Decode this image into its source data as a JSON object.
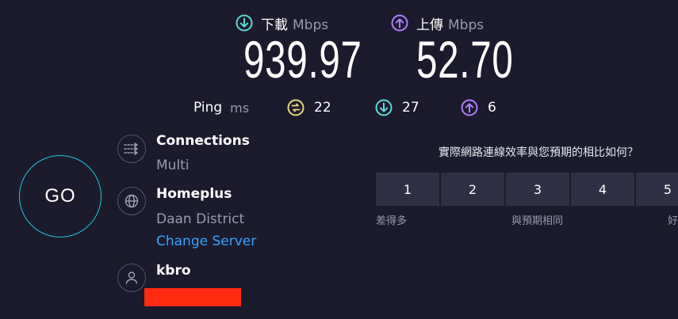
{
  "speed": {
    "download": {
      "label": "下載",
      "unit": "Mbps",
      "value": "939.97",
      "color": "#5ed8d8"
    },
    "upload": {
      "label": "上傳",
      "unit": "Mbps",
      "value": "52.70",
      "color": "#b47eff"
    }
  },
  "ping": {
    "label": "Ping",
    "unit": "ms",
    "idle": {
      "value": "22",
      "icon": "ping-idle-icon",
      "color": "#e7d77a"
    },
    "download": {
      "value": "27",
      "icon": "download-arrow-icon",
      "color": "#5ed8d8"
    },
    "upload": {
      "value": "6",
      "icon": "upload-arrow-icon",
      "color": "#b47eff"
    }
  },
  "go_label": "GO",
  "connections": {
    "title": "Connections",
    "value": "Multi"
  },
  "server": {
    "name": "Homeplus",
    "location": "Daan District",
    "change_label": "Change Server"
  },
  "provider": {
    "name": "kbro"
  },
  "rating": {
    "question": "實際網路連線效率與您預期的相比如何？",
    "options": [
      "1",
      "2",
      "3",
      "4",
      "5"
    ],
    "captions": {
      "low": "差得多",
      "mid": "與預期相同",
      "high": "好"
    }
  },
  "colors": {
    "background": "#1b1b2d",
    "go_ring": "#1fc3d8",
    "link": "#36a3ff",
    "redaction": "#ff2a10"
  }
}
